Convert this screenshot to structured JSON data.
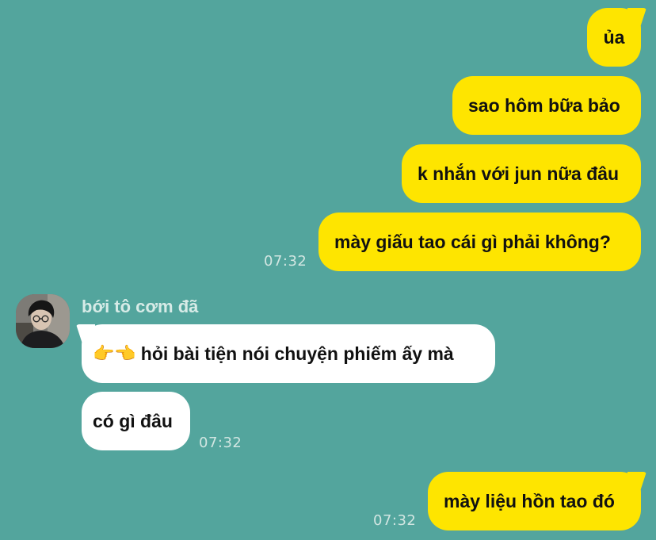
{
  "outgoing_group_1": {
    "messages": [
      "ủa",
      "sao hôm bữa bảo",
      "k nhắn với jun nữa đâu",
      "mày giấu tao cái gì phải không?"
    ],
    "time": "07:32"
  },
  "incoming_group": {
    "sender_name": "bới tô cơm đã",
    "avatar_icon": "person-photo-icon",
    "messages": [
      "hỏi bài tiện nói chuyện phiếm ấy mà",
      "có gì đâu"
    ],
    "emoji_prefix": "👉👈",
    "time": "07:32"
  },
  "outgoing_group_2": {
    "messages": [
      "mày liệu hồn tao đó"
    ],
    "time": "07:32"
  },
  "colors": {
    "background": "#53a59d",
    "outgoing_bubble": "#fee500",
    "incoming_bubble": "#ffffff",
    "timestamp": "#d2e6e2"
  }
}
